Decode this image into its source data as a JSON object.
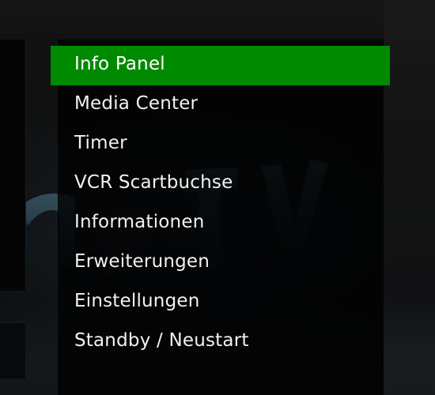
{
  "menu": {
    "selected_index": 0,
    "items": [
      {
        "label": "Info Panel"
      },
      {
        "label": "Media Center"
      },
      {
        "label": "Timer"
      },
      {
        "label": "VCR Scartbuchse"
      },
      {
        "label": "Informationen"
      },
      {
        "label": "Erweiterungen"
      },
      {
        "label": "Einstellungen"
      },
      {
        "label": "Standby / Neustart"
      }
    ]
  },
  "colors": {
    "selection_green": "#008a00",
    "menu_text": "#f2f2f2",
    "panel_background": "#000000"
  }
}
